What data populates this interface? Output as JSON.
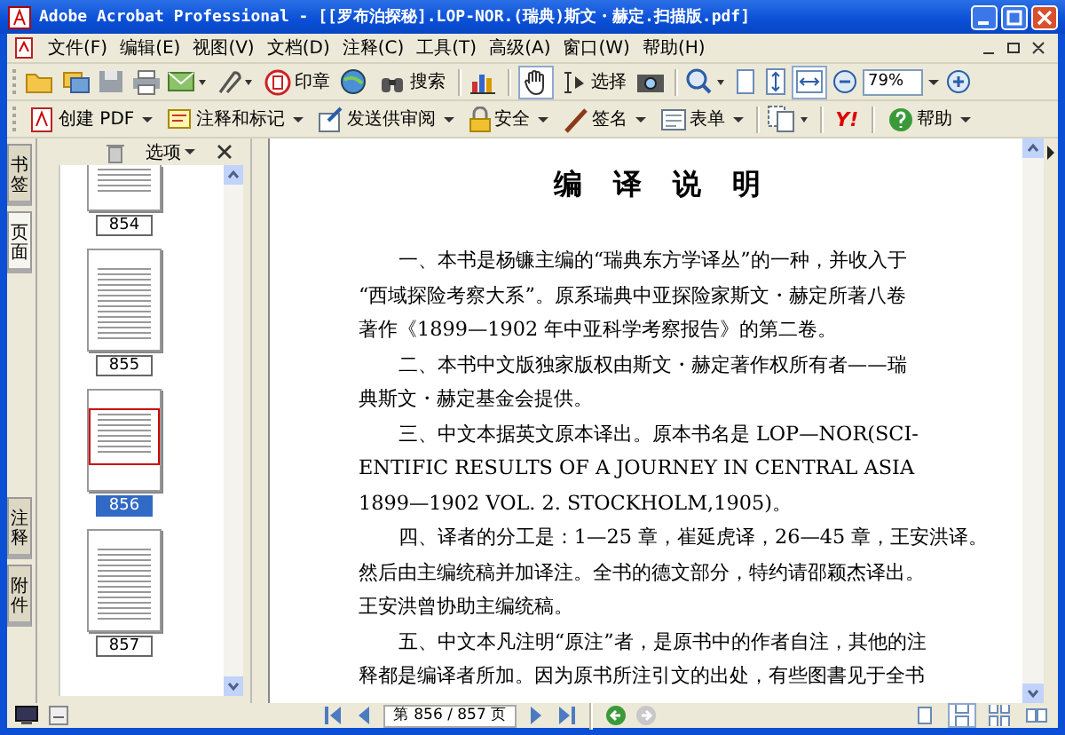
{
  "window": {
    "title": "Adobe Acrobat Professional - [[罗布泊探秘].LOP-NOR.(瑞典)斯文・赫定.扫描版.pdf]"
  },
  "menu": [
    {
      "label": "文件(F)"
    },
    {
      "label": "编辑(E)"
    },
    {
      "label": "视图(V)"
    },
    {
      "label": "文档(D)"
    },
    {
      "label": "注释(C)"
    },
    {
      "label": "工具(T)"
    },
    {
      "label": "高级(A)"
    },
    {
      "label": "窗口(W)"
    },
    {
      "label": "帮助(H)"
    }
  ],
  "toolbar1": {
    "stamp": "印章",
    "search": "搜索",
    "hand_tool": {
      "selected": true
    },
    "select_tool": {
      "label": "选择",
      "selected": false
    },
    "fit_page": {
      "selected": false
    },
    "fit_width": {
      "selected": true
    },
    "zoom": "79%"
  },
  "toolbar2": {
    "create_pdf": "创建 PDF",
    "comment": "注释和标记",
    "review": "发送供审阅",
    "security": "安全",
    "sign": "签名",
    "forms": "表单",
    "yahoo": "Y!",
    "help": "帮助"
  },
  "side_tabs": [
    {
      "label": "书签",
      "selected": false
    },
    {
      "label": "页面",
      "selected": true
    },
    {
      "label": "注释",
      "selected": false
    },
    {
      "label": "附件",
      "selected": false
    }
  ],
  "thumbnail_panel": {
    "options": "选项",
    "thumbnails": [
      {
        "label": "854",
        "selected": false
      },
      {
        "label": "855",
        "selected": false
      },
      {
        "label": "856",
        "selected": true
      },
      {
        "label": "857",
        "selected": false
      }
    ]
  },
  "document": {
    "title": "编 译 说 明",
    "paragraphs": [
      {
        "lines": [
          "一、本书是杨镰主编的“瑞典东方学译丛”的一种，并收入于",
          "“西域探险考察大系”。原系瑞典中亚探险家斯文・赫定所著八卷",
          "著作《1899—1902 年中亚科学考察报告》的第二卷。"
        ]
      },
      {
        "lines": [
          "二、本书中文版独家版权由斯文・赫定著作权所有者——瑞",
          "典斯文・赫定基金会提供。"
        ]
      },
      {
        "lines": [
          "三、中文本据英文原本译出。原本书名是 LOP—NOR(SCI-",
          "ENTIFIC RESULTS OF A JOURNEY IN CENTRAL ASIA",
          "1899—1902 VOL. 2. STOCKHOLM,1905)。"
        ]
      },
      {
        "lines": [
          "四、译者的分工是：1—25 章，崔延虎译，26—45 章，王安洪译。",
          "然后由主编统稿并加译注。全书的德文部分，特约请邵颖杰译出。",
          "王安洪曾协助主编统稿。"
        ]
      },
      {
        "lines": [
          "五、中文本凡注明“原注”者，是原书中的作者自注，其他的注",
          "释都是编译者所加。因为原书所注引文的出处，有些图書见于全书"
        ]
      }
    ]
  },
  "status_bar": {
    "page_field": "第 856 / 857 页",
    "forward_disabled": true,
    "layouts": [
      {
        "selected": false
      },
      {
        "selected": true
      },
      {
        "selected": false
      },
      {
        "selected": false
      }
    ]
  }
}
